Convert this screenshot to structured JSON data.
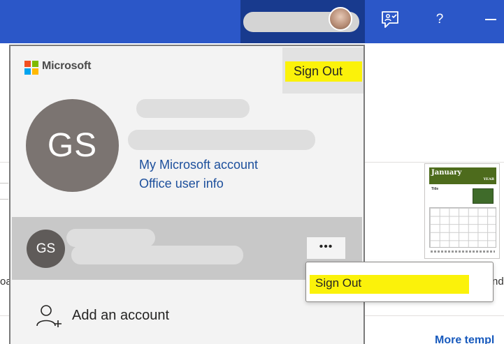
{
  "header": {
    "help_label": "?"
  },
  "background": {
    "left_cut_text": "oa",
    "right_cut_text": "nd",
    "more_templates_label": "More templ",
    "template_thumbnail": {
      "month": "January",
      "year": "YEAR",
      "title": "Title"
    }
  },
  "account_panel": {
    "brand": "Microsoft",
    "sign_out_label": "Sign Out",
    "initials": "GS",
    "links": [
      {
        "label": "My Microsoft account"
      },
      {
        "label": "Office user info"
      }
    ],
    "other_account": {
      "initials": "GS",
      "more_label": "•••"
    },
    "add_account_label": "Add an account"
  },
  "context_menu": {
    "items": [
      {
        "label": "Sign Out"
      }
    ]
  },
  "colors": {
    "topbar": "#2b57c8",
    "topbar_active": "#183a8e",
    "highlight": "#fbf20a",
    "link": "#1c4f9c",
    "avatar": "#7b7471"
  }
}
